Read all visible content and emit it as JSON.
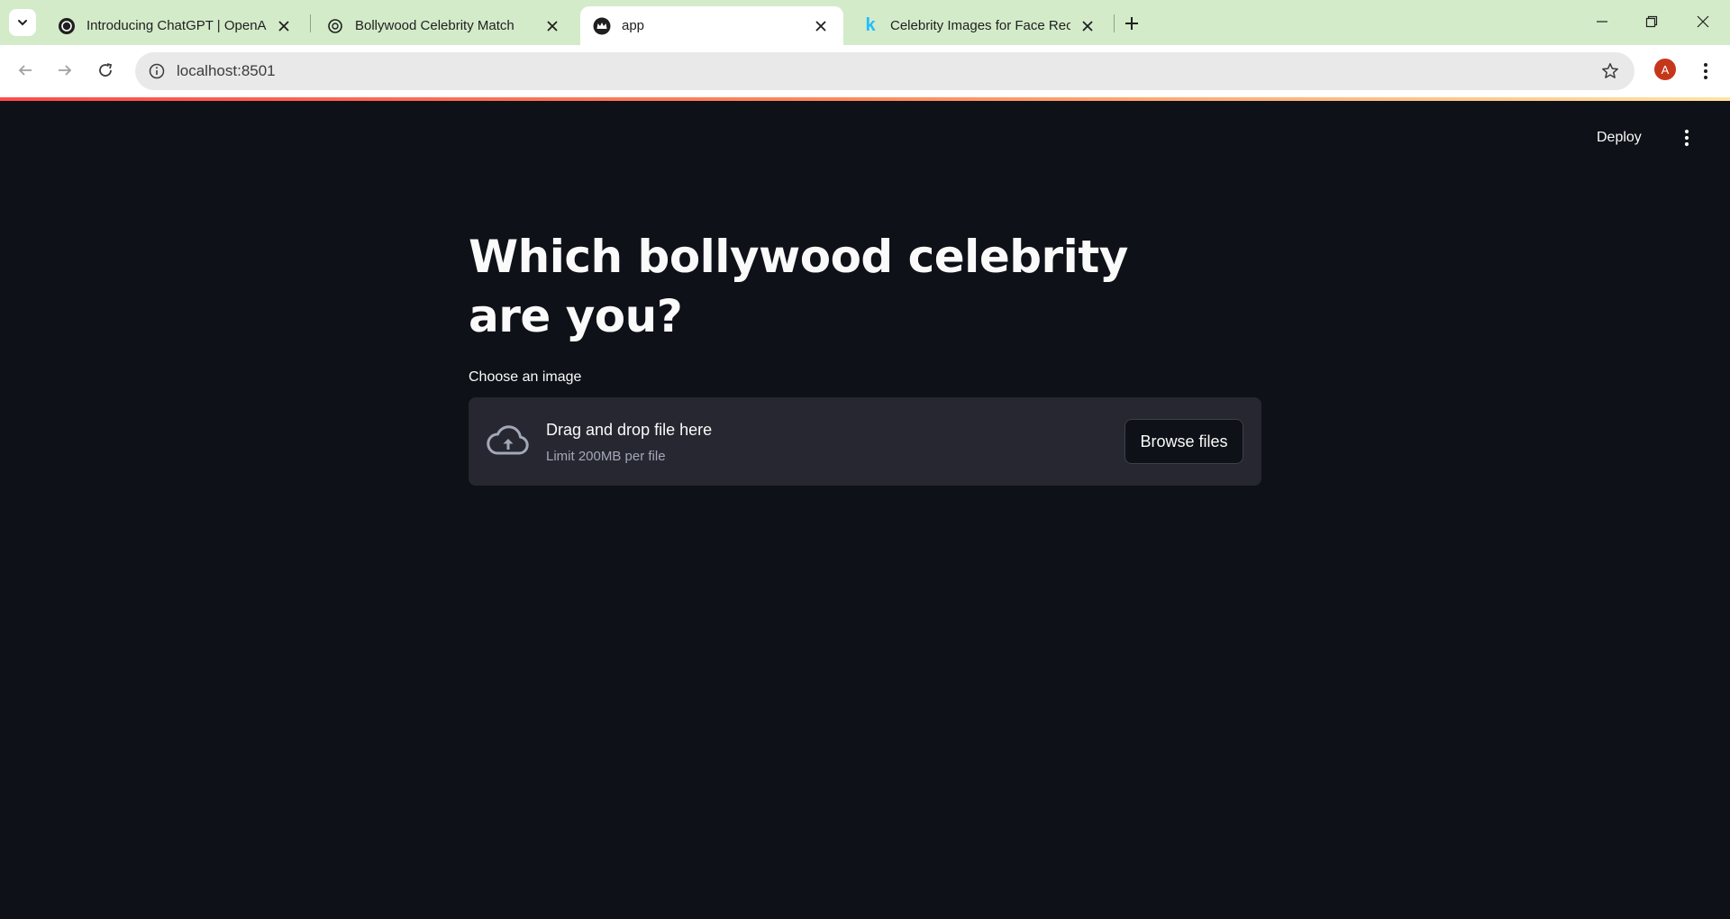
{
  "browser": {
    "tabs": [
      {
        "title": "Introducing ChatGPT | OpenAI",
        "favicon": "openai-icon",
        "active": false
      },
      {
        "title": "Bollywood Celebrity Match",
        "favicon": "openai-icon",
        "active": false
      },
      {
        "title": "app",
        "favicon": "streamlit-crown-icon",
        "active": true
      },
      {
        "title": "Celebrity Images for Face Recog",
        "favicon": "kaggle-k-icon",
        "active": false
      }
    ],
    "url": "localhost:8501",
    "profile_initial": "A",
    "colors": {
      "tabstrip": "#d3ebc9",
      "avatar": "#c5371b"
    }
  },
  "app": {
    "deploy_label": "Deploy",
    "title": "Which bollywood celebrity are you?",
    "uploader": {
      "label": "Choose an image",
      "drop_text": "Drag and drop file here",
      "limit_text": "Limit 200MB per file",
      "browse_label": "Browse files"
    },
    "colors": {
      "background": "#0e1117",
      "dropzone": "#262730",
      "text": "#fafafa",
      "muted": "#a3a8b8"
    }
  }
}
